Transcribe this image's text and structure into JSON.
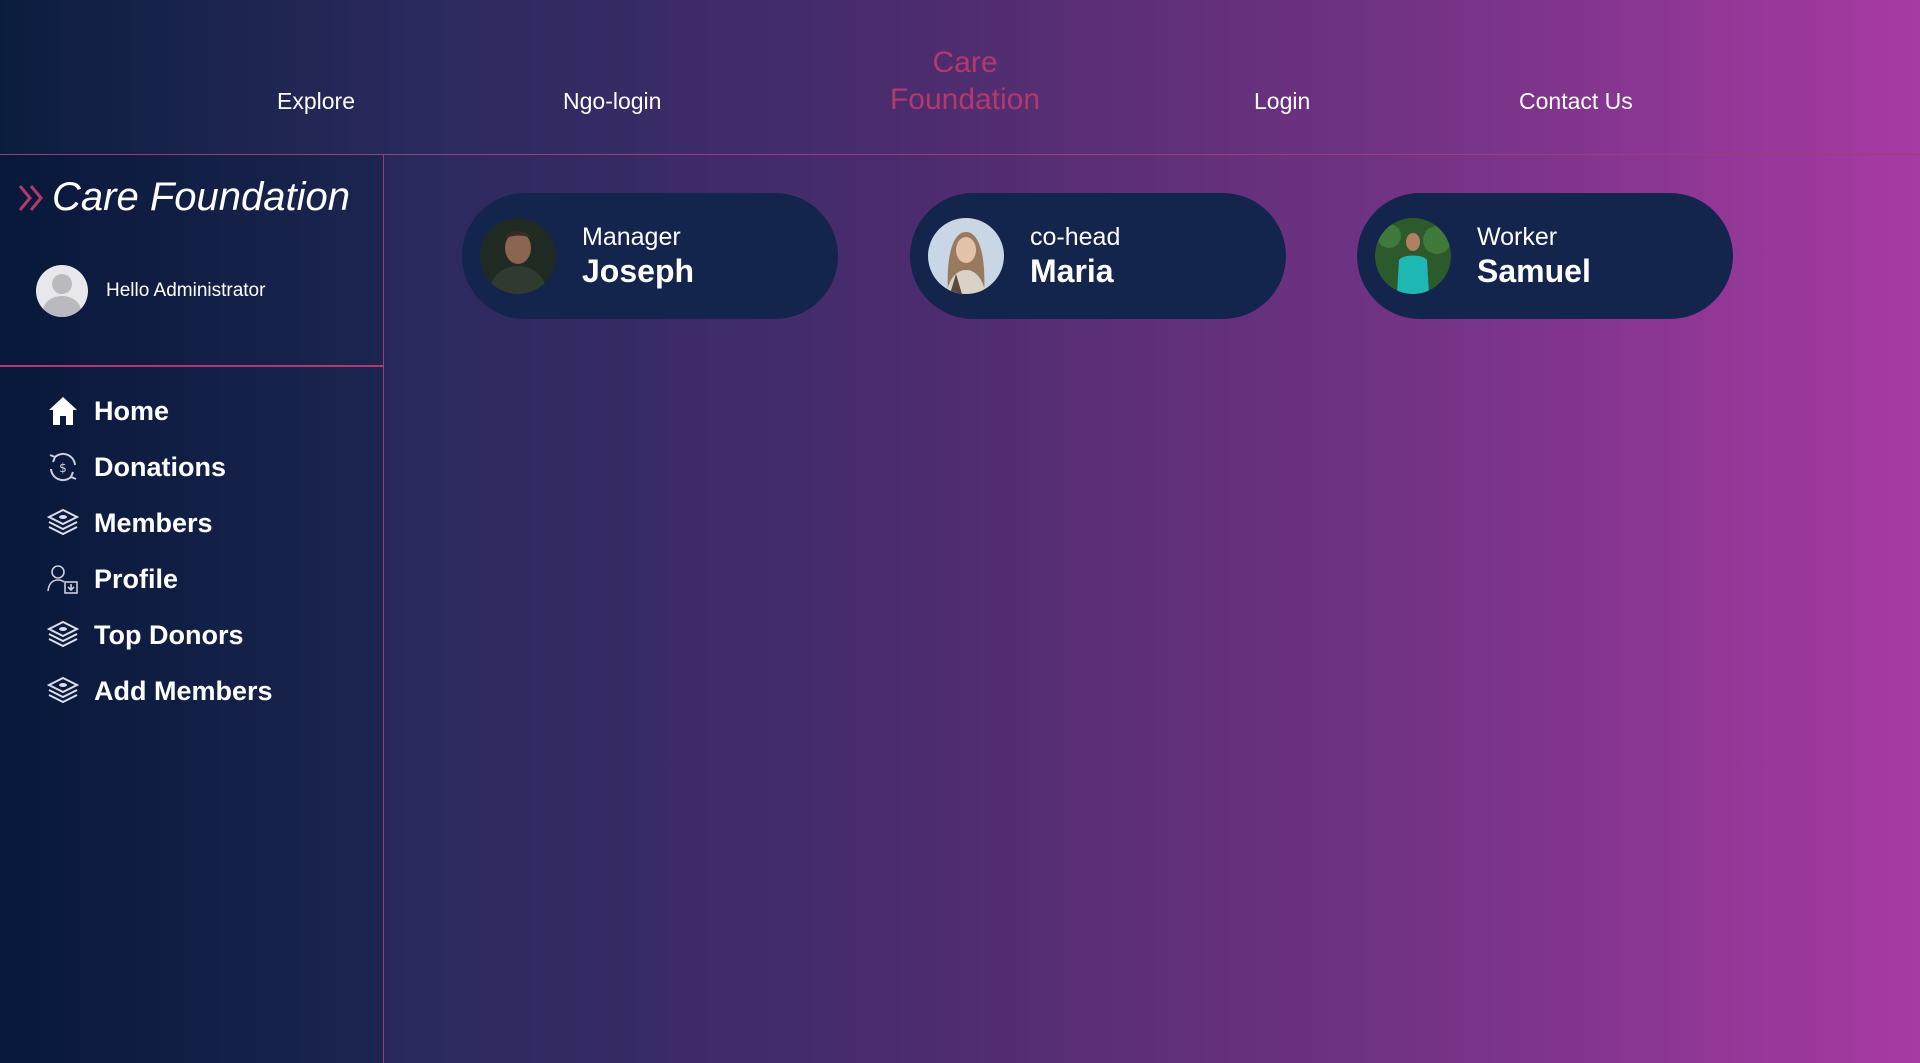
{
  "topnav": {
    "links": [
      "Explore",
      "Ngo-login",
      "Login",
      "Contact Us"
    ],
    "brand": [
      "Care",
      "Foundation"
    ]
  },
  "sidebar": {
    "brand": "Care Foundation",
    "greeting": "Hello Administrator",
    "menu": [
      {
        "label": "Home",
        "icon": "home-icon"
      },
      {
        "label": "Donations",
        "icon": "donation-cycle-icon"
      },
      {
        "label": "Members",
        "icon": "money-stack-icon"
      },
      {
        "label": "Profile",
        "icon": "user-download-icon"
      },
      {
        "label": "Top Donors",
        "icon": "money-stack-icon"
      },
      {
        "label": "Add Members",
        "icon": "money-stack-icon"
      }
    ]
  },
  "cards": [
    {
      "role": "Manager",
      "name": "Joseph"
    },
    {
      "role": "co-head",
      "name": "Maria"
    },
    {
      "role": "Worker",
      "name": "Samuel"
    }
  ],
  "colors": {
    "accent": "#b3386b",
    "card_bg": "#13254c",
    "divider": "#9a3d7a"
  }
}
